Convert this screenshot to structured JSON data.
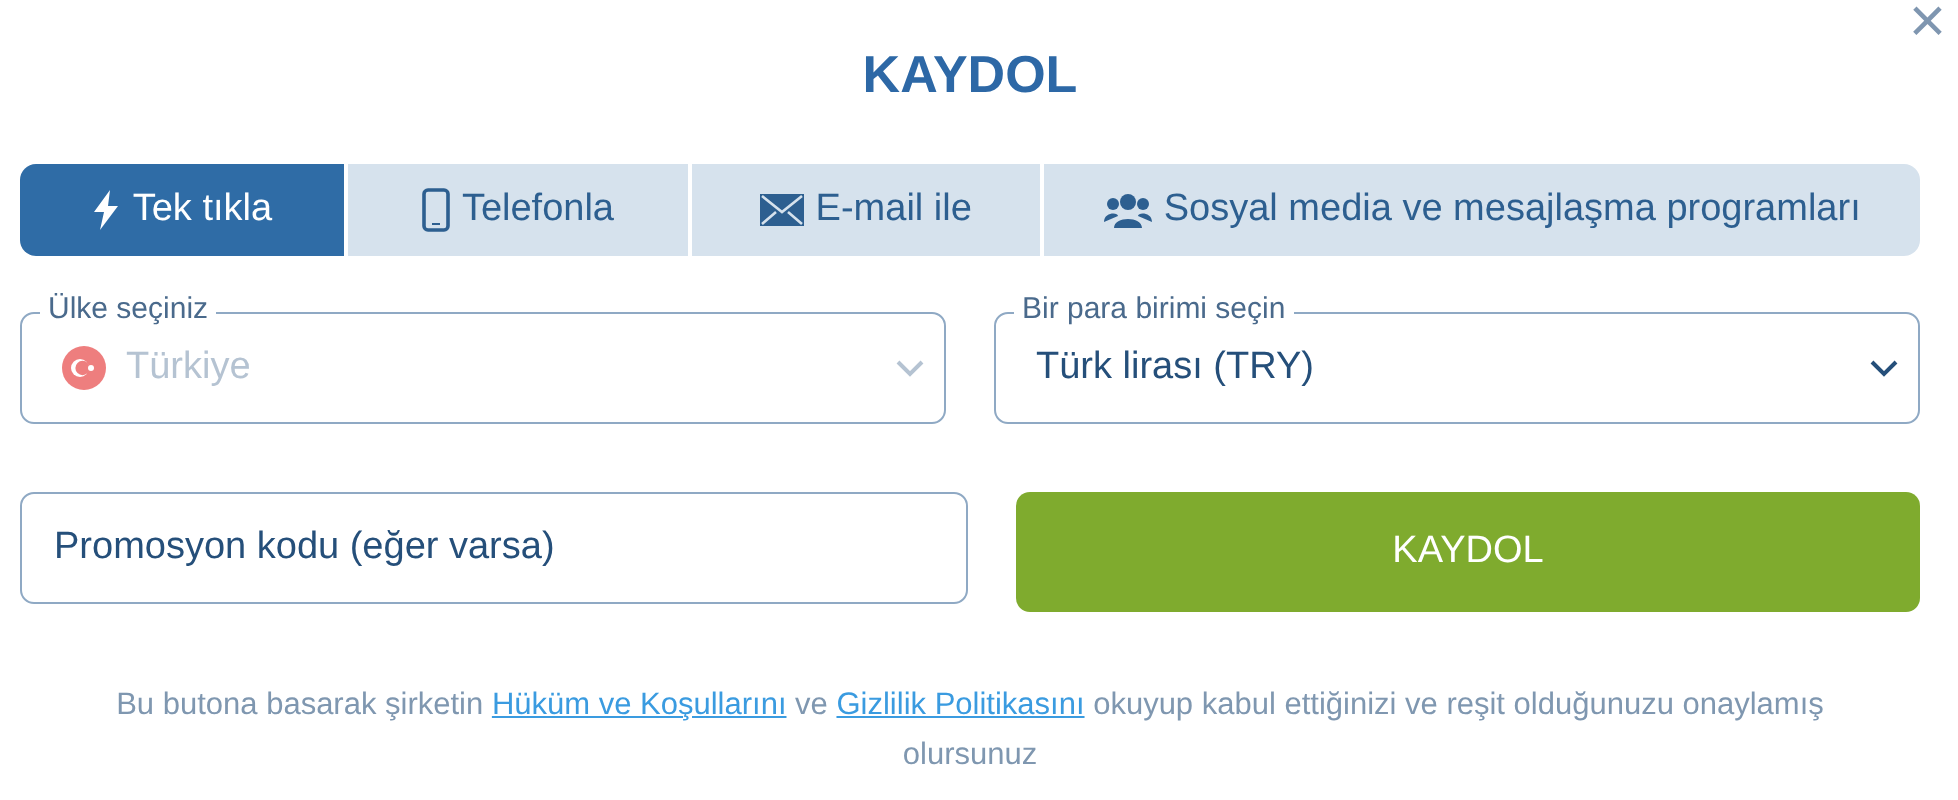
{
  "dialog": {
    "title": "KAYDOL",
    "close": "×"
  },
  "tabs": [
    {
      "label": "Tek tıkla",
      "kind": "bolt",
      "selected": true
    },
    {
      "label": "Telefonla",
      "kind": "phone",
      "selected": false
    },
    {
      "label": "E-mail ile",
      "kind": "mail",
      "selected": false
    },
    {
      "label": "Sosyal media ve mesajlaşma programları",
      "kind": "users",
      "selected": false
    }
  ],
  "country": {
    "label": "Ülke seçiniz",
    "value": "Türkiye",
    "disabled": true
  },
  "currency": {
    "label": "Bir para birimi seçin",
    "value": "Türk lirası (TRY)",
    "disabled": false
  },
  "promo": {
    "placeholder": "Promosyon kodu (eğer varsa)"
  },
  "submit": "KAYDOL",
  "terms": [
    {
      "kind": "text",
      "text": "Bu butona basarak şirketin "
    },
    {
      "kind": "link",
      "text": "Hüküm ve Koşullarını"
    },
    {
      "kind": "text",
      "text": " ve "
    },
    {
      "kind": "link",
      "text": "Gizlilik Politikasını"
    },
    {
      "kind": "text",
      "text": " okuyup kabul ettiğinizi ve reşit olduğunuzu onaylamış olursunuz"
    }
  ]
}
